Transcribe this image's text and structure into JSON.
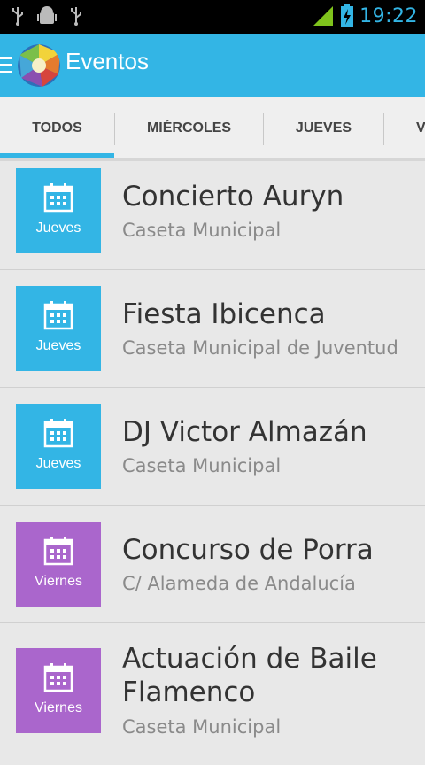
{
  "statusbar": {
    "time": "19:22",
    "icons_left": [
      "usb-icon",
      "android-debug-icon",
      "usb-icon"
    ],
    "icons_right": [
      "signal-icon",
      "battery-charging-icon"
    ]
  },
  "actionbar": {
    "title": "Eventos",
    "color": "#33b5e5"
  },
  "tabs": [
    {
      "label": "TODOS",
      "selected": true
    },
    {
      "label": "MIÉRCOLES",
      "selected": false
    },
    {
      "label": "JUEVES",
      "selected": false
    },
    {
      "label": "V",
      "selected": false
    }
  ],
  "colors": {
    "jueves": "#33b5e5",
    "viernes": "#aa66cc"
  },
  "events": [
    {
      "day": "Jueves",
      "title": "Concierto Auryn",
      "place": "Caseta Municipal"
    },
    {
      "day": "Jueves",
      "title": "Fiesta Ibicenca",
      "place": "Caseta Municipal de Juventud"
    },
    {
      "day": "Jueves",
      "title": "DJ Victor Almazán",
      "place": "Caseta Municipal"
    },
    {
      "day": "Viernes",
      "title": "Concurso de Porra",
      "place": "C/ Alameda de Andalucía"
    },
    {
      "day": "Viernes",
      "title": "Actuación de Baile Flamenco",
      "place": "Caseta Municipal"
    }
  ]
}
